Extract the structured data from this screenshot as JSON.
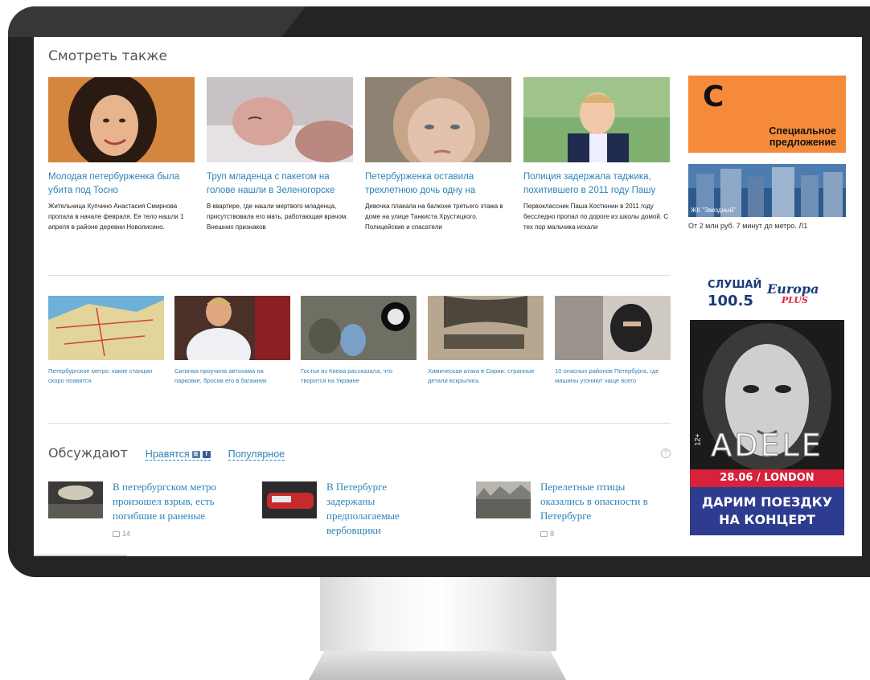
{
  "section": {
    "title": "Смотреть также"
  },
  "top_cards": [
    {
      "title": "Молодая петербурженка была убита под Тосно",
      "lead": "Жительница Купчино Анастасия Смирнова пропала в начале февраля. Ее тело нашли 1 апреля в районе деревни Новолисино."
    },
    {
      "title": "Труп младенца с пакетом на голове нашли в Зеленогорске",
      "lead": "В квартире, где нашли мертвого младенца, присутствовала его мать, работающая врачом. Внешних признаков"
    },
    {
      "title": "Петербурженка оставила трехлетнюю дочь одну на",
      "lead": "Девочка плакала на балконе третьего этажа в доме на улице Танкиста Хрустицкого. Полицейские и спасатели"
    },
    {
      "title": "Полиция задержала таджика, похитившего в 2011 году Пашу",
      "lead": "Первоклассник Паша Костюнин в 2011 году бесследно пропал по дороге из школы домой. С тех пор мальчика искали"
    }
  ],
  "mid_cards": [
    {
      "title": "Петербургское метро: какие станции скоро появятся"
    },
    {
      "title": "Силачка проучила автохама на парковке, бросив его в багажник"
    },
    {
      "title": "Гостья из Киева рассказала, что творится на Украине"
    },
    {
      "title": "Химическая атака в Сирии: странные детали вскрылись"
    },
    {
      "title": "10 опасных районов Петербурга, где машины угоняют чаще всего"
    }
  ],
  "discuss": {
    "title": "Обсуждают",
    "tabs": {
      "liked": "Нравятся",
      "vk": "B",
      "fb": "f",
      "popular": "Популярное"
    },
    "help": "?",
    "items": [
      {
        "title": "В петербургском метро произошел взрыв, есть погибшие и раненые",
        "comments": "14"
      },
      {
        "title": "В Петербурге задержаны предполагаемые вербовщики",
        "comments": ""
      },
      {
        "title": "Перелетные птицы оказались в опасности в Петербурге",
        "comments": "8"
      }
    ]
  },
  "ads": {
    "special": {
      "letter": "С",
      "line1": "Специальное",
      "line2": "предложение"
    },
    "city": {
      "label": "ЖК \"Звездный\"",
      "caption": "От 2 млн руб. 7 минут до метро. Л1"
    },
    "europa": {
      "listen": "СЛУШАЙ",
      "freq": "100.5",
      "brand": "Europa",
      "plus": "PLUS",
      "artist": "ADELE",
      "age": "12+",
      "date": "28.06 / LONDON",
      "promo1": "ДАРИМ ПОЕЗДКУ",
      "promo2": "НА КОНЦЕРТ"
    }
  }
}
